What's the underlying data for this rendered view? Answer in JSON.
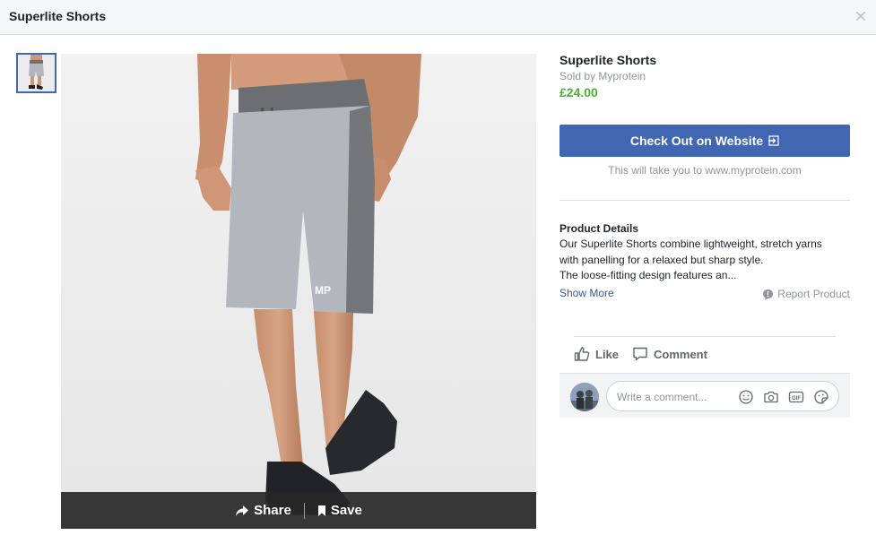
{
  "header": {
    "title": "Superlite Shorts"
  },
  "gallery": {
    "thumbnail_icon": "product-thumbnail",
    "share_label": "Share",
    "save_label": "Save"
  },
  "product": {
    "title": "Superlite Shorts",
    "seller": "Sold by Myprotein",
    "price": "£24.00",
    "price_color": "#42b72a"
  },
  "checkout": {
    "button_label": "Check Out on Website",
    "button_color": "#4267b2",
    "note": "This will take you to www.myprotein.com"
  },
  "details": {
    "heading": "Product Details",
    "line1": "Our Superlite Shorts combine lightweight, stretch yarns",
    "line2": "with panelling for a relaxed but sharp style.",
    "line3": "The loose-fitting design features an...",
    "show_more": "Show More",
    "report": "Report Product"
  },
  "actions": {
    "like": "Like",
    "comment": "Comment"
  },
  "comment_box": {
    "placeholder": "Write a comment...",
    "icons": [
      "emoji-icon",
      "camera-icon",
      "gif-icon",
      "sticker-icon"
    ]
  }
}
